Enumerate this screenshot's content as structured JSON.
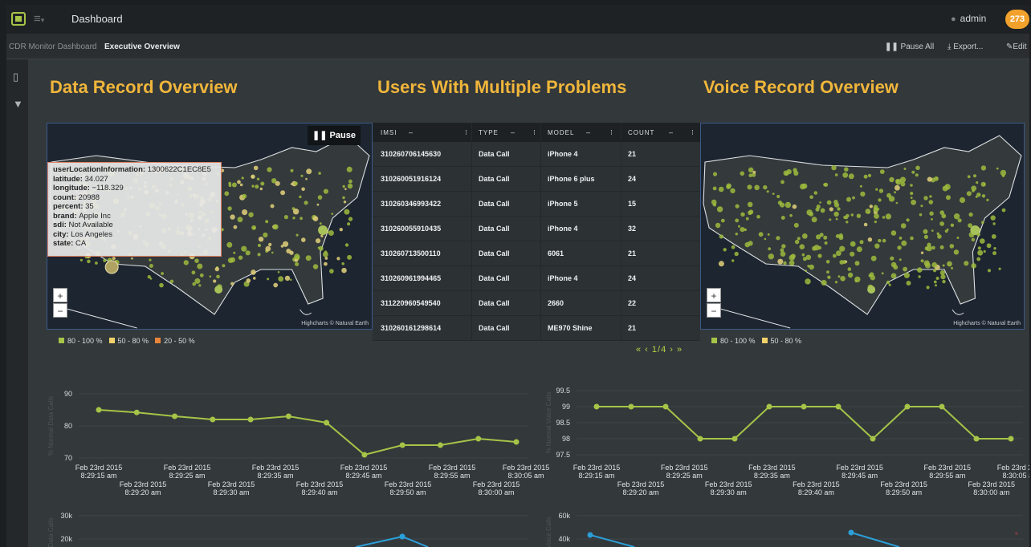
{
  "header": {
    "app_title": "Dashboard",
    "user": "admin",
    "notifications": "273"
  },
  "breadcrumb": {
    "root": "CDR Monitor Dashboard",
    "separator": "›",
    "current": "Executive Overview"
  },
  "toolbar": {
    "pause_all": "Pause All",
    "export": "Export...",
    "edit": "Edit"
  },
  "panels": {
    "data_title": "Data Record Overview",
    "users_title": "Users With Multiple Problems",
    "voice_title": "Voice Record Overview"
  },
  "data_map": {
    "pause_label": "Pause",
    "credit": "Highcharts © Natural Earth",
    "zoom_in": "+",
    "zoom_out": "−",
    "tooltip": {
      "userLocationInformation": "1300622C1EC8E5",
      "latitude": "34.027",
      "longitude": "−118.329",
      "count": "20988",
      "percent": "35",
      "brand": "Apple Inc",
      "sdi": "Not Available",
      "city": "Los Angeles",
      "state": "CA"
    },
    "legend": [
      {
        "label": "80 - 100 %",
        "color": "#a6c447"
      },
      {
        "label": "50 - 80 %",
        "color": "#f2d16b"
      },
      {
        "label": "20 - 50 %",
        "color": "#e8853a"
      }
    ]
  },
  "voice_map": {
    "credit": "Highcharts © Natural Earth",
    "zoom_in": "+",
    "zoom_out": "−",
    "legend": [
      {
        "label": "80 - 100 %",
        "color": "#a6c447"
      },
      {
        "label": "50 - 80 %",
        "color": "#f2d16b"
      }
    ]
  },
  "users_table": {
    "columns": [
      "IMSI",
      "TYPE",
      "MODEL",
      "COUNT"
    ],
    "rows": [
      [
        "310260706145630",
        "Data Call",
        "iPhone 4",
        "21"
      ],
      [
        "310260051916124",
        "Data Call",
        "iPhone 6 plus",
        "24"
      ],
      [
        "310260346993422",
        "Data Call",
        "iPhone 5",
        "15"
      ],
      [
        "310260055910435",
        "Data Call",
        "iPhone 4",
        "32"
      ],
      [
        "310260713500110",
        "Data Call",
        "6061",
        "21"
      ],
      [
        "310260961994465",
        "Data Call",
        "iPhone 4",
        "24"
      ],
      [
        "311220960549540",
        "Data Call",
        "2660",
        "22"
      ],
      [
        "310260161298614",
        "Data Call",
        "ME970 Shine",
        "21"
      ]
    ],
    "pager": "« ‹ 1/4 › »"
  },
  "chart_data": [
    {
      "type": "line",
      "ylabel": "% Normal Data Calls",
      "ylim": [
        70,
        90
      ],
      "yticks": [
        "90",
        "80",
        "70"
      ],
      "x": [
        "8:29:15 am",
        "8:29:20 am",
        "8:29:25 am",
        "8:29:30 am",
        "8:29:35 am",
        "8:29:35 am",
        "8:29:40 am",
        "8:29:45 am",
        "8:29:50 am",
        "8:29:55 am",
        "8:30:00 am",
        "8:30:05 am"
      ],
      "values": [
        85,
        84.2,
        83,
        82,
        82,
        83,
        81,
        71,
        74,
        74,
        76,
        75
      ],
      "xlabels_top": [
        "Feb 23rd 2015",
        "Feb 23rd 2015",
        "Feb 23rd 2015",
        "Feb 23rd 2015",
        "Feb 23rd 2015",
        "Feb 23rd 2015"
      ],
      "xtimes_top": [
        "8:29:15 am",
        "8:29:25 am",
        "8:29:35 am",
        "8:29:45 am",
        "8:29:55 am",
        "8:30:05 am"
      ],
      "xlabels_bottom": [
        "Feb 23rd 2015",
        "Feb 23rd 2015",
        "Feb 23rd 2015",
        "Feb 23rd 2015",
        "Feb 23rd 2015"
      ],
      "xtimes_bottom": [
        "8:29:20 am",
        "8:29:30 am",
        "8:29:40 am",
        "8:29:50 am",
        "8:30:00 am"
      ],
      "color": "#a6c447"
    },
    {
      "type": "line",
      "ylabel": "% Normal Voice Calls",
      "ylim": [
        97.5,
        99.5
      ],
      "yticks": [
        "99.5",
        "99",
        "98.5",
        "98",
        "97.5"
      ],
      "x": [
        "8:29:15 am",
        "8:29:20 am",
        "8:29:25 am",
        "8:29:30 am",
        "8:29:33 am",
        "8:29:33 am",
        "8:29:38 am",
        "8:29:43 am",
        "8:29:43 am",
        "8:29:48 am",
        "8:29:53 am",
        "8:29:58 am",
        "8:30:03 am"
      ],
      "values": [
        99,
        99,
        99,
        98,
        98,
        99,
        99,
        99,
        98,
        99,
        99,
        98,
        98
      ],
      "xlabels_top": [
        "Feb 23rd 2015",
        "Feb 23rd 2015",
        "Feb 23rd 2015",
        "Feb 23rd 2015",
        "Feb 23rd 2015",
        "Feb 23rd 2015"
      ],
      "xtimes_top": [
        "8:29:15 am",
        "8:29:25 am",
        "8:29:35 am",
        "8:29:45 am",
        "8:29:55 am",
        "8:30:05 am"
      ],
      "xlabels_bottom": [
        "Feb 23rd 2015",
        "Feb 23rd 2015",
        "Feb 23rd 2015",
        "Feb 23rd 2015",
        "Feb 23rd 2015"
      ],
      "xtimes_bottom": [
        "8:29:20 am",
        "8:29:30 am",
        "8:29:40 am",
        "8:29:50 am",
        "8:30:00 am"
      ],
      "color": "#a6c447"
    },
    {
      "type": "line",
      "ylabel": "Data Calls",
      "yticks": [
        "30k",
        "20k"
      ],
      "values_partial": [
        20000,
        22000
      ],
      "color": "#2b9fd9"
    },
    {
      "type": "line",
      "ylabel": "Voice Calls",
      "yticks": [
        "60k",
        "40k"
      ],
      "values_partial": [
        41000,
        41000
      ],
      "color": "#2b9fd9"
    }
  ]
}
